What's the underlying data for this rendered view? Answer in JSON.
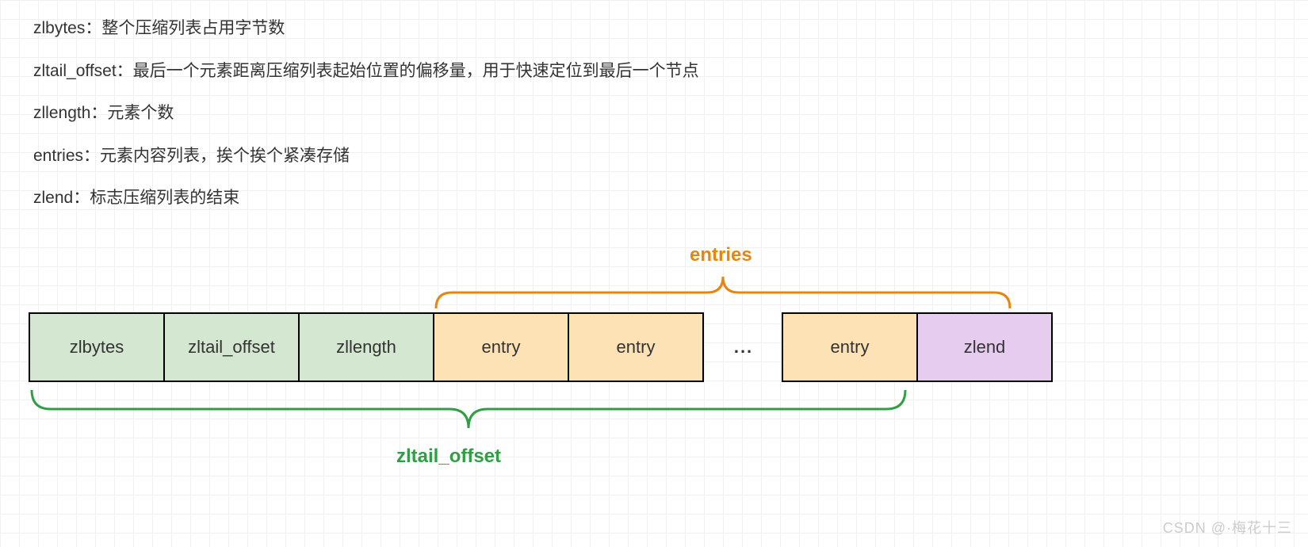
{
  "definitions": {
    "zlbytes": "zlbytes：整个压缩列表占用字节数",
    "zltail_offset": "zltail_offset：最后一个元素距离压缩列表起始位置的偏移量，用于快速定位到最后一个节点",
    "zllength": "zllength：元素个数",
    "entries": "entries：元素内容列表，挨个挨个紧凑存储",
    "zlend": "zlend：标志压缩列表的结束"
  },
  "diagram": {
    "cells": {
      "zlbytes": "zlbytes",
      "zltail_offset": "zltail_offset",
      "zllength": "zllength",
      "entry1": "entry",
      "entry2": "entry",
      "ellipsis": "...",
      "entry3": "entry",
      "zlend": "zlend"
    },
    "top_brace_label": "entries",
    "bottom_brace_label": "zltail_offset"
  },
  "colors": {
    "green": "#d4e8d1",
    "orange_fill": "#fde2b6",
    "purple": "#e6cdf0",
    "orange_text": "#e8850f",
    "green_text": "#2f9e44"
  },
  "watermark": "CSDN @·梅花十三"
}
